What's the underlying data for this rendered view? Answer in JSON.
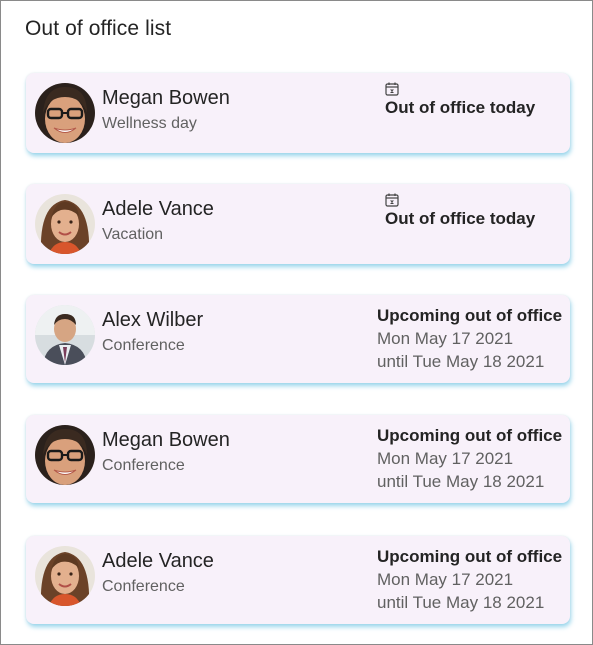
{
  "page": {
    "title": "Out of office list"
  },
  "entries": [
    {
      "name": "Megan Bowen",
      "reason": "Wellness day",
      "status_title": "Out of office today",
      "icon": "calendar-icon",
      "avatar": "megan"
    },
    {
      "name": "Adele Vance",
      "reason": "Vacation",
      "status_title": "Out of office today",
      "icon": "calendar-icon",
      "avatar": "adele"
    },
    {
      "name": "Alex Wilber",
      "reason": "Conference",
      "status_title": "Upcoming out of office",
      "date_from": "Mon May 17 2021",
      "date_until": "until Tue May 18 2021",
      "avatar": "alex"
    },
    {
      "name": "Megan Bowen",
      "reason": "Conference",
      "status_title": "Upcoming out of office",
      "date_from": "Mon May 17 2021",
      "date_until": "until Tue May 18 2021",
      "avatar": "megan"
    },
    {
      "name": "Adele Vance",
      "reason": "Conference",
      "status_title": "Upcoming out of office",
      "date_from": "Mon May 17 2021",
      "date_until": "until Tue May 18 2021",
      "avatar": "adele"
    }
  ],
  "colors": {
    "card_background": "#f8f1fa",
    "card_shadow": "#78c8e6",
    "primary_text": "#242424",
    "secondary_text": "#616161"
  }
}
